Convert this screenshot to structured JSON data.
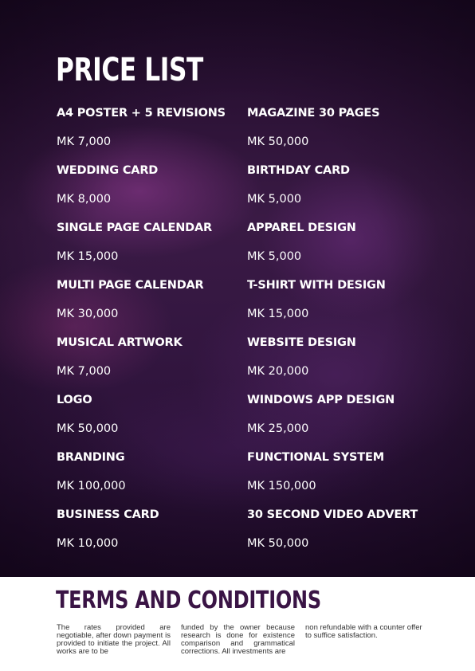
{
  "header": {
    "title": "PRICE LIST"
  },
  "prices": {
    "left": [
      {
        "name": "A4 POSTER + 5 REVISIONS",
        "price": "MK 7,000"
      },
      {
        "name": "WEDDING  CARD",
        "price": "MK 8,000"
      },
      {
        "name": "SINGLE PAGE CALENDAR",
        "price": "MK 15,000"
      },
      {
        "name": "MULTI PAGE CALENDAR",
        "price": "MK 30,000"
      },
      {
        "name": "MUSICAL ARTWORK",
        "price": "MK 7,000"
      },
      {
        "name": "LOGO",
        "price": "MK 50,000"
      },
      {
        "name": "BRANDING",
        "price": "MK 100,000"
      },
      {
        "name": "BUSINESS CARD",
        "price": "MK 10,000"
      }
    ],
    "right": [
      {
        "name": "MAGAZINE 30 PAGES",
        "price": "MK 50,000"
      },
      {
        "name": "BIRTHDAY CARD",
        "price": "MK 5,000"
      },
      {
        "name": "APPAREL DESIGN",
        "price": "MK 5,000"
      },
      {
        "name": "T-SHIRT WITH DESIGN",
        "price": "MK 15,000"
      },
      {
        "name": "WEBSITE DESIGN",
        "price": "MK 20,000"
      },
      {
        "name": "WINDOWS APP DESIGN",
        "price": "MK 25,000"
      },
      {
        "name": "FUNCTIONAL SYSTEM",
        "price": "MK 150,000"
      },
      {
        "name": "30 SECOND VIDEO ADVERT",
        "price": "MK 50,000"
      }
    ]
  },
  "terms": {
    "title": "TERMS AND CONDITIONS",
    "col1": "The rates provided are negotiable, after down payment is provided to initiate the project. All works are to be",
    "col2": "funded by the owner because research is done for existence comparison and grammatical corrections. All investments are",
    "col3": "non refundable with a counter offer to suffice satisfaction."
  },
  "colors": {
    "background_dark": "#2c1236",
    "accent_purple": "#3a1445",
    "text_light": "#ffffff"
  }
}
